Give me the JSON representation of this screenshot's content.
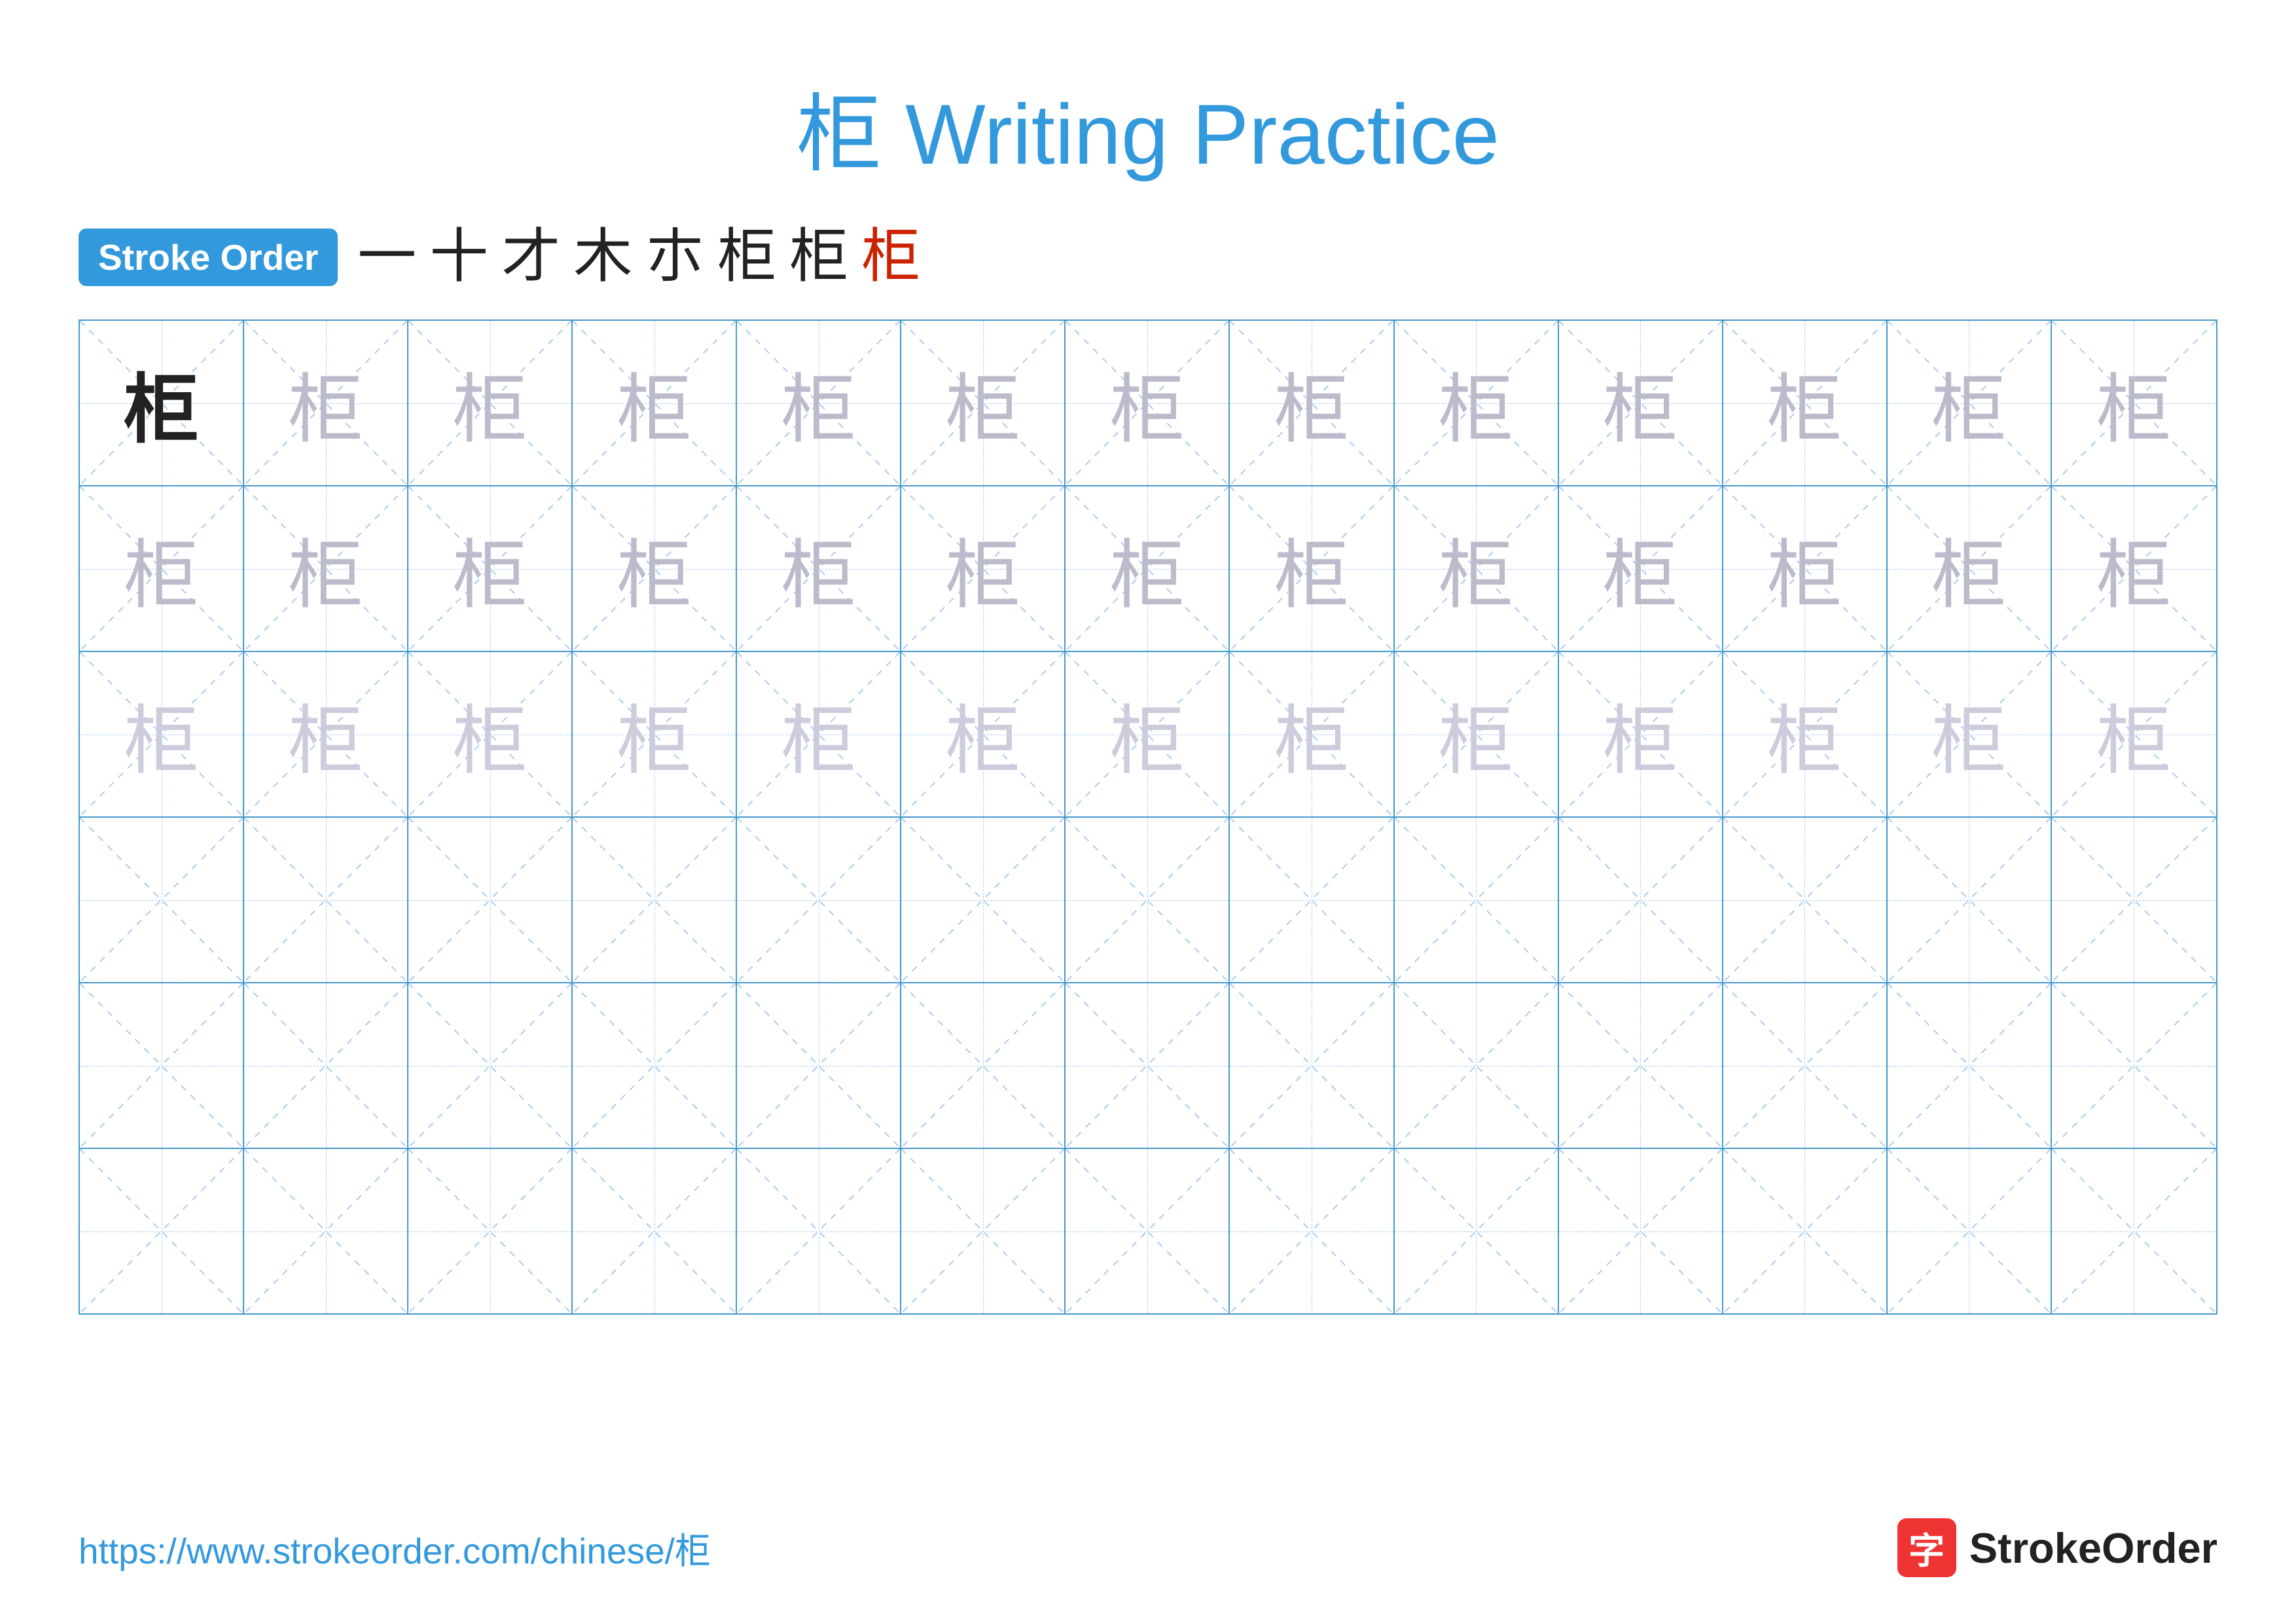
{
  "page": {
    "title": "柜 Writing Practice",
    "title_chinese": "柜",
    "title_text": "Writing Practice",
    "title_color": "#3399dd"
  },
  "stroke_order": {
    "badge_label": "Stroke Order",
    "strokes": [
      "一",
      "十",
      "才",
      "木",
      "木",
      "柜",
      "柜",
      "柜"
    ],
    "stroke_colors": [
      "black",
      "black",
      "black",
      "black",
      "black",
      "black",
      "black",
      "red"
    ]
  },
  "grid": {
    "rows": 6,
    "cols": 13,
    "character": "柜",
    "row_types": [
      "dark-first",
      "medium-gray",
      "light-gray",
      "empty",
      "empty",
      "empty"
    ]
  },
  "footer": {
    "url": "https://www.strokeorder.com/chinese/柜",
    "logo_char": "字",
    "logo_name": "StrokeOrder"
  }
}
